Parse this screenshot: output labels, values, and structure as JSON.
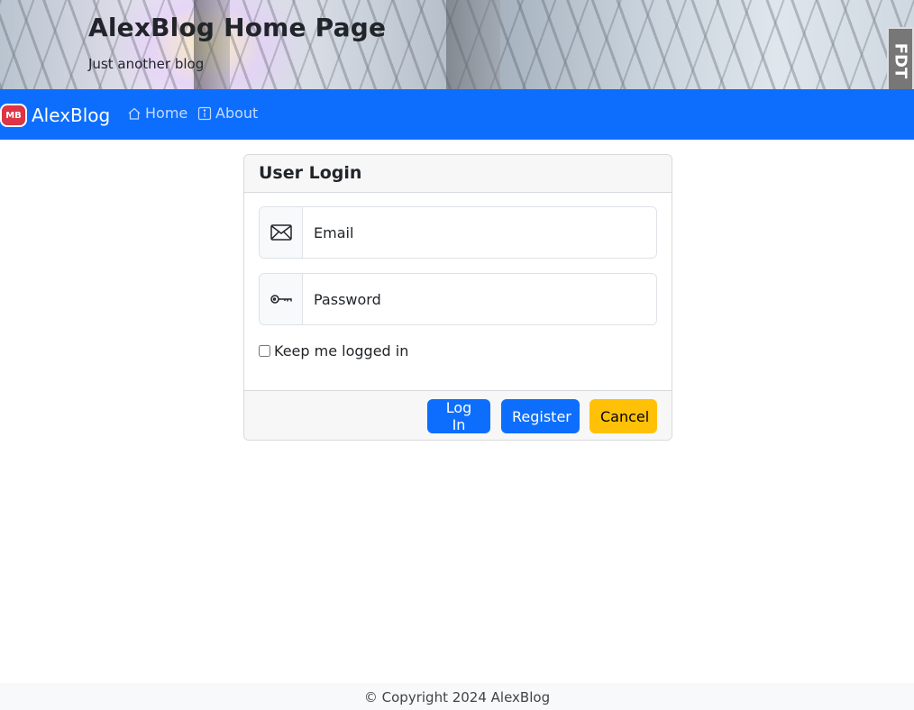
{
  "header": {
    "title": "AlexBlog Home Page",
    "subtitle": "Just another blog",
    "badge": "FDT"
  },
  "navbar": {
    "logo_text": "MB",
    "brand": "AlexBlog",
    "links": [
      {
        "label": "Home",
        "icon": "house-icon"
      },
      {
        "label": "About",
        "icon": "info-square-icon"
      }
    ]
  },
  "login_card": {
    "title": "User Login",
    "email": {
      "placeholder": "Email",
      "value": "",
      "icon": "envelope-icon"
    },
    "password": {
      "placeholder": "Password",
      "value": "",
      "icon": "key-icon"
    },
    "remember_label": "Keep me logged in",
    "remember_checked": false,
    "buttons": {
      "login": "Log In",
      "register": "Register",
      "cancel": "Cancel"
    }
  },
  "footer": {
    "text": "© Copyright 2024 AlexBlog"
  },
  "colors": {
    "primary": "#0d6efd",
    "warning": "#ffc107",
    "logo_red": "#dc3545"
  }
}
